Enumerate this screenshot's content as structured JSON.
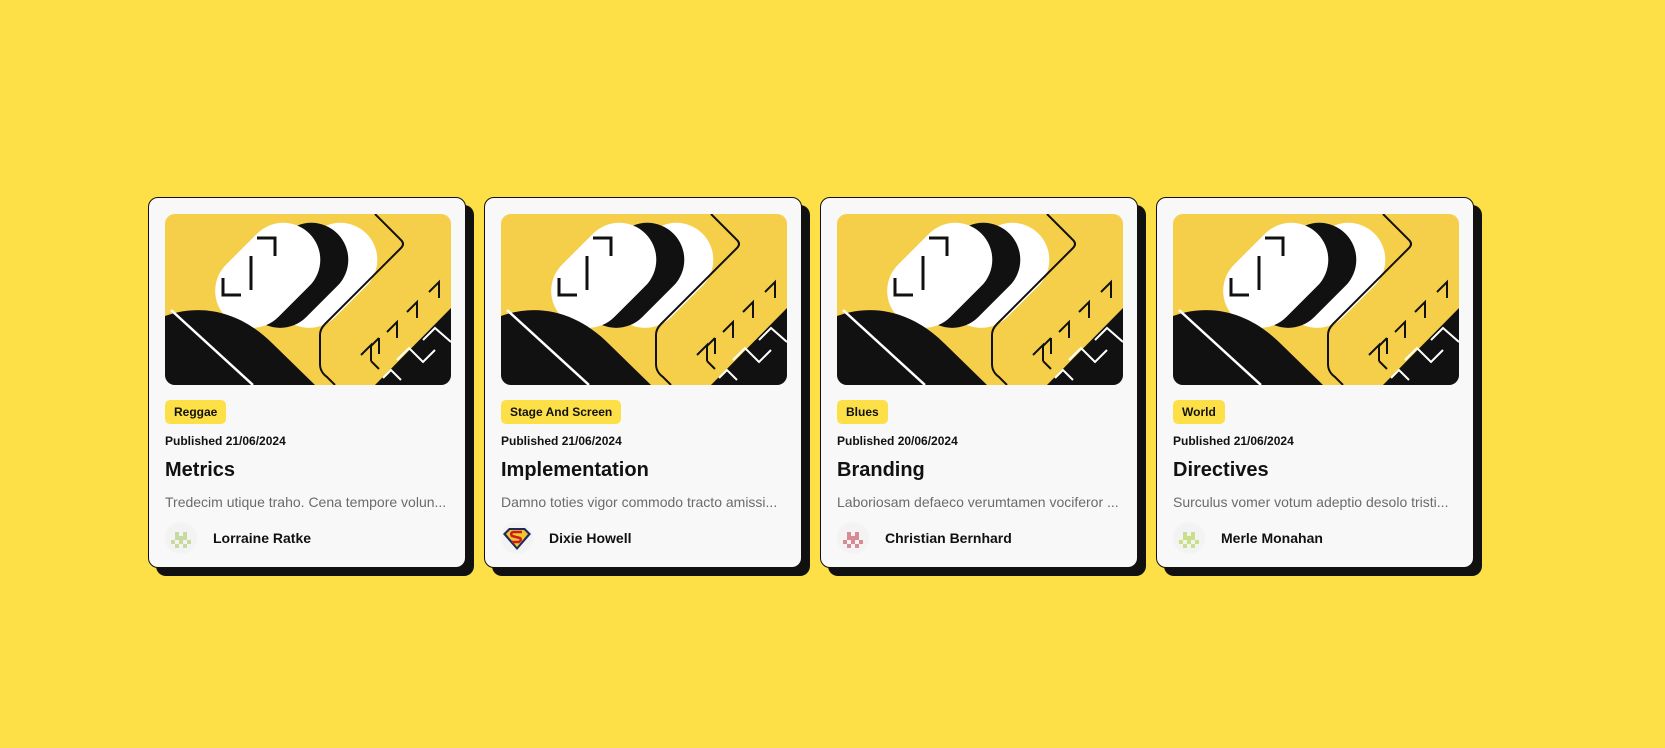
{
  "cards": [
    {
      "category": "Reggae",
      "published_label": "Published",
      "date": "21/06/2024",
      "title": "Metrics",
      "excerpt": "Tredecim utique traho. Cena tempore volun...",
      "author": "Lorraine Ratke",
      "avatar_icon": "pixel-avatar-icon",
      "avatar_color": "#c7dba0"
    },
    {
      "category": "Stage And Screen",
      "published_label": "Published",
      "date": "21/06/2024",
      "title": "Implementation",
      "excerpt": "Damno toties vigor commodo tracto amissi...",
      "author": "Dixie Howell",
      "avatar_icon": "superman-shield-icon",
      "avatar_color": "#c81e1e"
    },
    {
      "category": "Blues",
      "published_label": "Published",
      "date": "20/06/2024",
      "title": "Branding",
      "excerpt": "Laboriosam defaeco verumtamen vociferor ...",
      "author": "Christian Bernhard",
      "avatar_icon": "pixel-avatar-icon",
      "avatar_color": "#d98b95"
    },
    {
      "category": "World",
      "published_label": "Published",
      "date": "21/06/2024",
      "title": "Directives",
      "excerpt": "Surculus vomer votum adeptio desolo tristi...",
      "author": "Merle Monahan",
      "avatar_icon": "pixel-avatar-icon",
      "avatar_color": "#c9df8a"
    }
  ],
  "colors": {
    "background": "#fde047",
    "cover_background": "#f5cf4a",
    "ink": "#111111",
    "card": "#f8f8f8"
  }
}
